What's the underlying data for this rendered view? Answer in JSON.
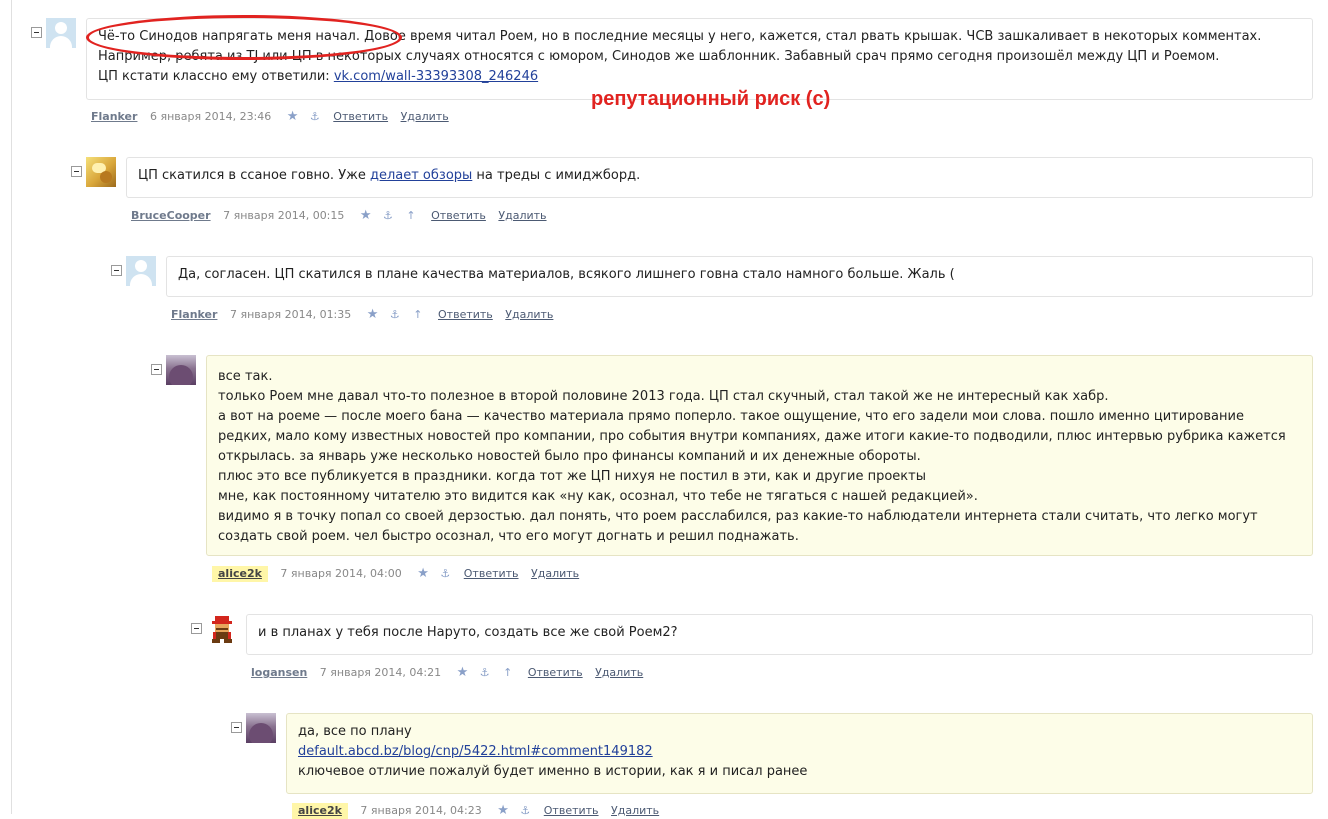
{
  "annotation": "репутационный риск (с)",
  "comments": [
    {
      "author": "Flanker",
      "date": "6 января 2014, 23:46",
      "text_before": "Чё-то Синодов напрягать меня начал. Довое время читал Роем, но в последние месяцы у него, кажется, стал рвать крышак. ЧСВ зашкаливает в некоторых комментах.\nНапример, ребята из TJ или ЦП в некоторых случаях относятся с юмором, Синодов же шаблонник. Забавный срач прямо сегодня произошёл между ЦП и Роемом.\nЦП кстати классно ему ответили: ",
      "link": "vk.com/wall-33393308_246246",
      "reply": "Ответить",
      "delete": "Удалить"
    },
    {
      "author": "BruceCooper",
      "date": "7 января 2014, 00:15",
      "text_before": "ЦП скатился в ссаное говно. Уже ",
      "link": "делает обзоры",
      "text_after": " на треды с имиджборд.",
      "reply": "Ответить",
      "delete": "Удалить"
    },
    {
      "author": "Flanker",
      "date": "7 января 2014, 01:35",
      "text": "Да, согласен. ЦП скатился в плане качества материалов, всякого лишнего говна стало намного больше. Жаль (",
      "reply": "Ответить",
      "delete": "Удалить"
    },
    {
      "author": "alice2k",
      "date": "7 января 2014, 04:00",
      "text": "все так.\nтолько Роем мне давал что-то полезное в второй половине 2013 года. ЦП стал скучный, стал такой же не интересный как хабр.\nа вот на роеме — после моего бана — качество материала прямо поперло. такое ощущение, что его задели мои слова. пошло именно цитирование редких, мало кому известных новостей про компании, про события внутри компаниях, даже итоги какие-то подводили, плюс интервью рубрика кажется открылась. за январь уже несколько новостей было про финансы компаний и их денежные обороты.\nплюс это все публикуется в праздники. когда тот же ЦП нихуя не постил в эти, как и другие проекты\nмне, как постоянному читателю это видится как «ну как, осознал, что тебе не тягаться с нашей редакцией».\nвидимо я в точку попал со своей дерзостью. дал понять, что роем расслабился, раз какие-то наблюдатели интернета стали считать, что легко могут создать свой роем. чел быстро осознал, что его могут догнать и решил поднажать.",
      "reply": "Ответить",
      "delete": "Удалить"
    },
    {
      "author": "logansen",
      "date": "7 января 2014, 04:21",
      "text": "и в планах у тебя после Наруто, создать все же свой Роем2?",
      "reply": "Ответить",
      "delete": "Удалить"
    },
    {
      "author": "alice2k",
      "date": "7 января 2014, 04:23",
      "text_before": "да, все по плану\n",
      "link": "default.abcd.bz/blog/cnp/5422.html#comment149182",
      "text_after": "\nключевое отличие пожалуй будет именно в истории, как я и писал ранее",
      "reply": "Ответить",
      "delete": "Удалить"
    }
  ],
  "icons": {
    "toggle": "collapse-minus-icon",
    "star": "★",
    "anchor": "⚓",
    "parent": "↑"
  },
  "colors": {
    "annotation": "#e12320",
    "highlight_bg": "#fdfde8",
    "author_highlight": "#fff6a8",
    "link": "#22419a"
  }
}
